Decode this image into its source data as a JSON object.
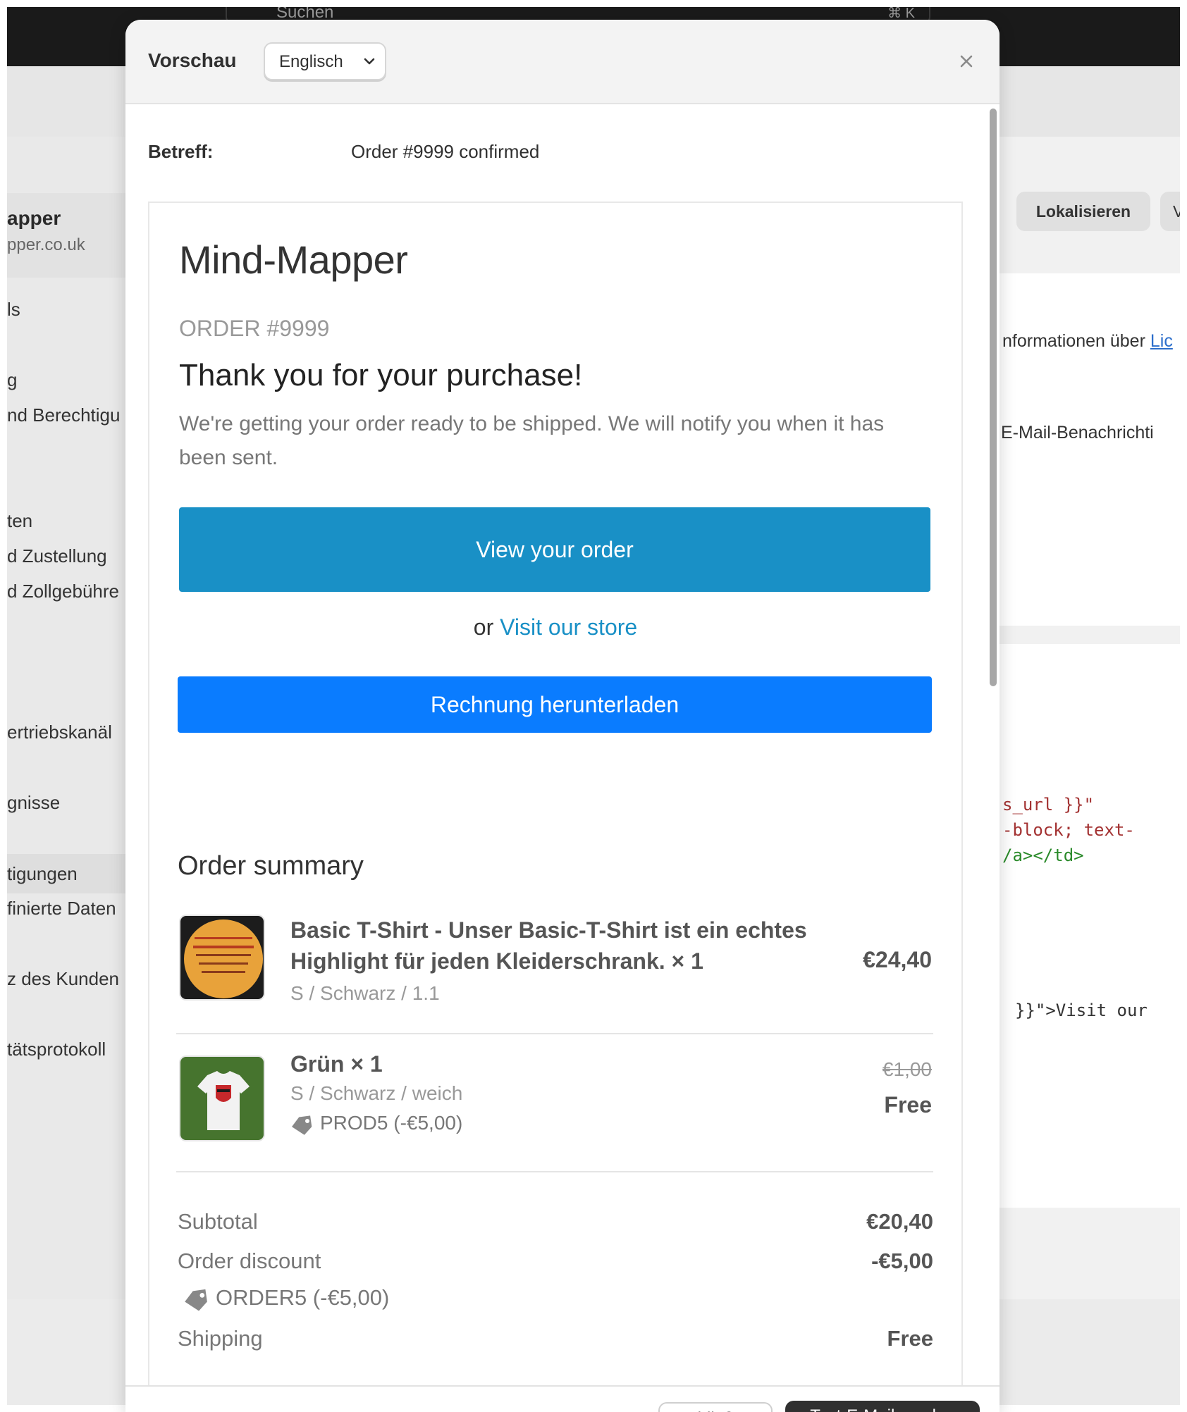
{
  "background": {
    "search_placeholder": "Suchen",
    "search_shortcut": "⌘ K",
    "store_name": "apper",
    "store_url": "pper.co.uk",
    "sidebar_items": [
      "ls",
      "g",
      "nd Berechtigu",
      "ten",
      "d Zustellung",
      "d Zollgebühre",
      "ertriebskanäl",
      "gnisse",
      "tigungen",
      "finierte Daten",
      "z des Kunden",
      "tätsprotokoll"
    ],
    "localize_button": "Lokalisieren",
    "next_button_fragment": "V",
    "info_text": "nformationen über",
    "info_link": "Lic",
    "email_notif_text": "E-Mail-Benachrichti",
    "code_lines": [
      "s_url }}\"",
      "-block; text-",
      "/a></td>",
      "}}\">Visit our"
    ]
  },
  "modal": {
    "title": "Vorschau",
    "language": "Englisch",
    "close_icon": "close-icon",
    "subject_label": "Betreff:",
    "subject_value": "Order #9999 confirmed",
    "footer_secondary": "Schließen",
    "footer_primary": "Test-E-Mail senden"
  },
  "email": {
    "shop_name": "Mind-Mapper",
    "order_number": "ORDER #9999",
    "heading": "Thank you for your purchase!",
    "intro": "We're getting your order ready to be shipped. We will notify you when it has been sent.",
    "view_order_button": "View your order",
    "or_text": "or",
    "visit_store_link": "Visit our store",
    "invoice_button": "Rechnung herunterladen",
    "summary_title": "Order summary",
    "line_items": [
      {
        "title": "Basic T-Shirt - Unser Basic-T-Shirt ist ein echtes Highlight für jeden Kleiderschrank. × 1",
        "variant": "S / Schwarz / 1.1",
        "price": "€24,40"
      },
      {
        "title": "Grün × 1",
        "variant": "S / Schwarz / weich",
        "discount": "PROD5 (-€5,00)",
        "original_price": "€1,00",
        "price": "Free"
      }
    ],
    "totals": {
      "subtotal_label": "Subtotal",
      "subtotal_value": "€20,40",
      "order_discount_label": "Order discount",
      "order_discount_value": "-€5,00",
      "discount_code": "ORDER5 (-€5,00)",
      "shipping_label": "Shipping",
      "shipping_value": "Free"
    }
  },
  "colors": {
    "primary_button": "#1990c6",
    "invoice_button": "#0a7cff",
    "link": "#1990c6"
  }
}
